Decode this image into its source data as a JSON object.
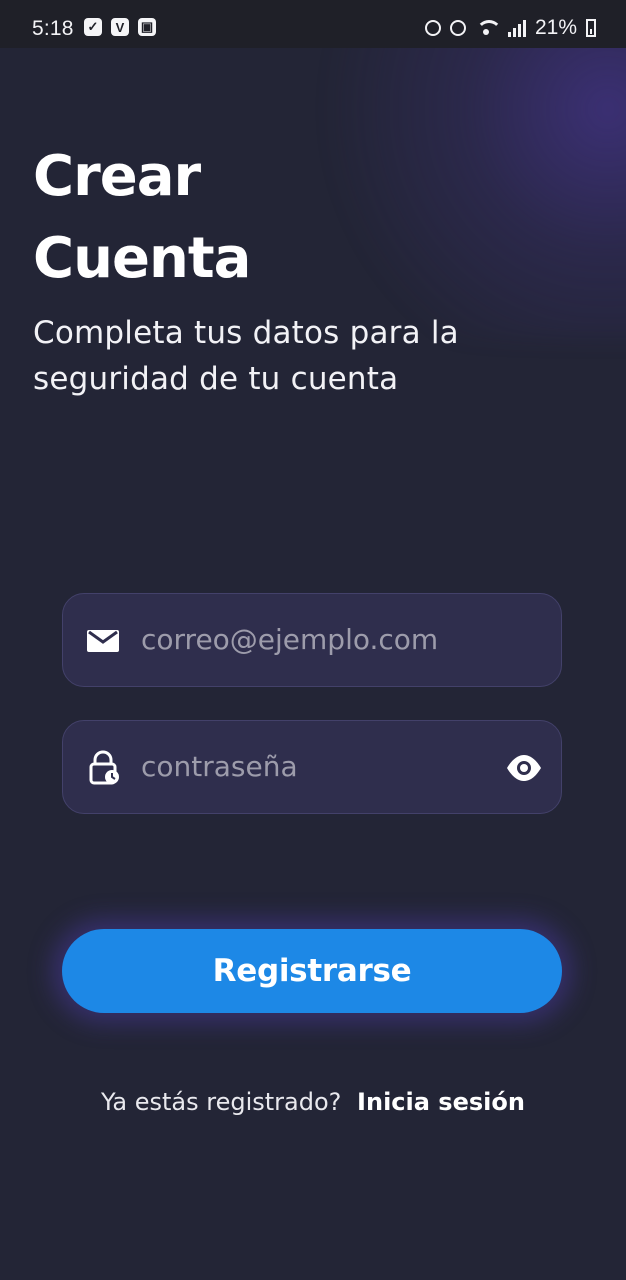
{
  "status_bar": {
    "time": "5:18",
    "battery_percent": "21%",
    "left_icons": [
      "check-box-icon",
      "v-app-icon",
      "image-icon"
    ],
    "right_icons": [
      "privacy-icon",
      "alarm-icon",
      "wifi-icon",
      "signal-icon",
      "battery-icon"
    ]
  },
  "header": {
    "title": "Crear\nCuenta",
    "subtitle": "Completa tus datos para la seguridad de tu cuenta"
  },
  "form": {
    "email": {
      "placeholder": "correo@ejemplo.com",
      "value": "",
      "icon": "mail-icon"
    },
    "password": {
      "placeholder": "contraseña",
      "value": "",
      "icon": "lock-clock-icon",
      "visibility_icon": "eye-icon"
    },
    "submit_label": "Registrarse"
  },
  "footer": {
    "question": "Ya estás registrado?",
    "login_label": "Inicia sesión"
  },
  "colors": {
    "background": "#232536",
    "input_background": "#2f2e4d",
    "button": "#1d88e6",
    "accent_glow": "#4c3aa5"
  }
}
